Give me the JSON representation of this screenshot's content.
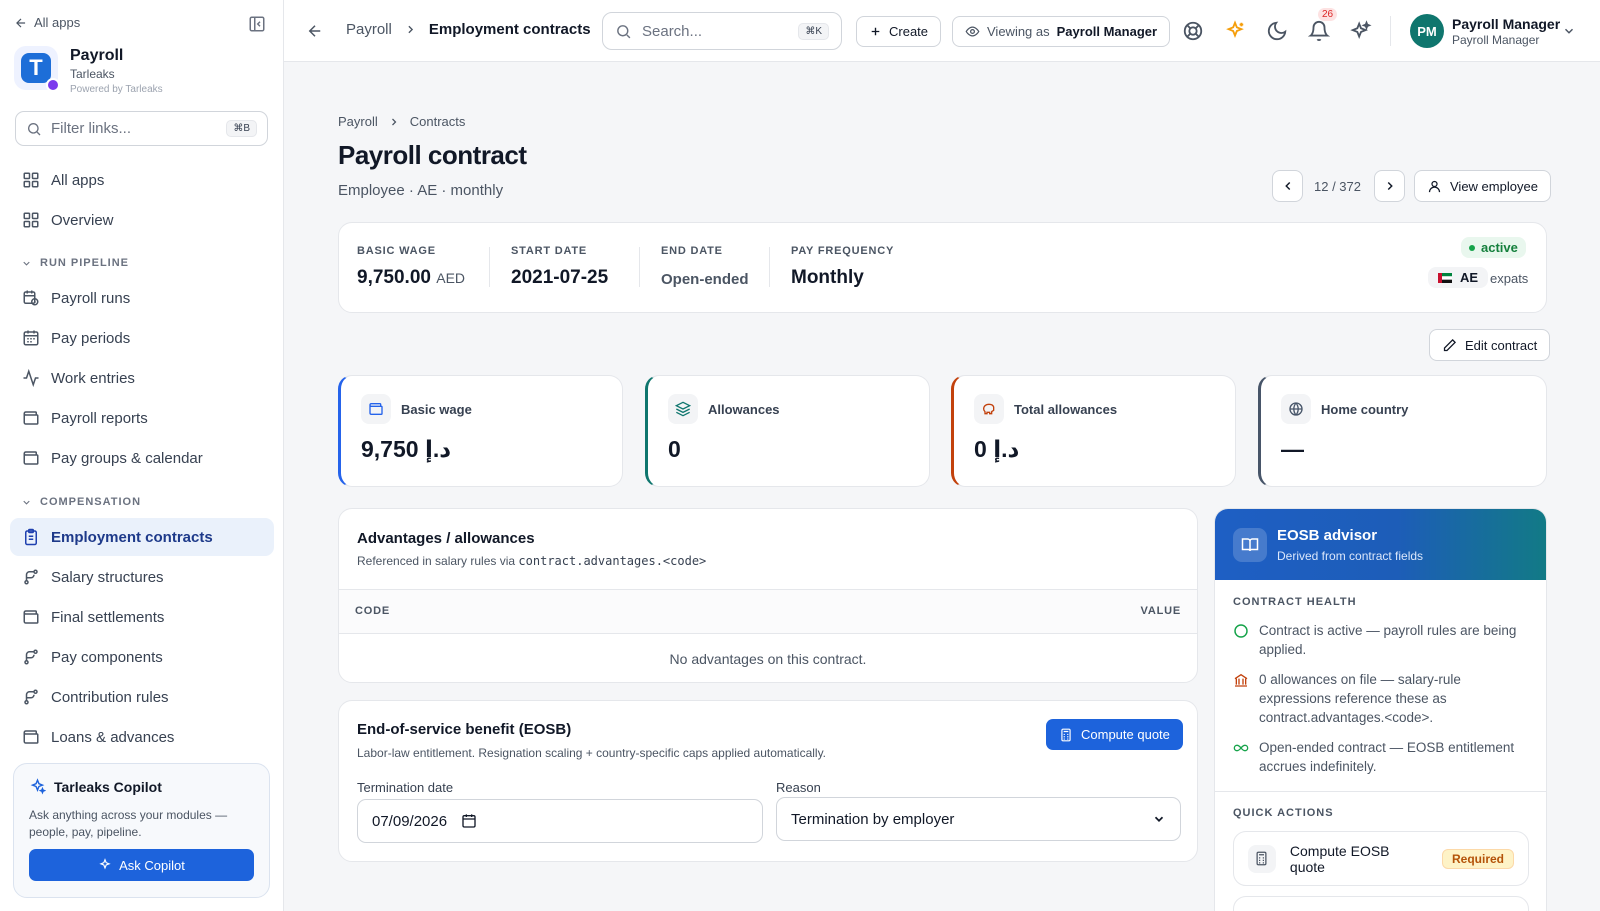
{
  "sidebar": {
    "all_apps": "All apps",
    "brand": {
      "name": "Payroll",
      "org": "Tarleaks",
      "powered": "Powered by Tarleaks",
      "logo_letter": "T"
    },
    "filter": {
      "placeholder": "Filter links...",
      "shortcut": "⌘B"
    },
    "top_items": [
      {
        "label": "All apps",
        "icon": "grid-icon"
      },
      {
        "label": "Overview",
        "icon": "grid-icon"
      }
    ],
    "sections": [
      {
        "title": "RUN PIPELINE",
        "items": [
          {
            "label": "Payroll runs",
            "icon": "calendar-clock-icon"
          },
          {
            "label": "Pay periods",
            "icon": "calendar-icon"
          },
          {
            "label": "Work entries",
            "icon": "activity-icon"
          },
          {
            "label": "Payroll reports",
            "icon": "wallet-icon"
          },
          {
            "label": "Pay groups & calendar",
            "icon": "wallet-icon"
          }
        ]
      },
      {
        "title": "COMPENSATION",
        "items": [
          {
            "label": "Employment contracts",
            "icon": "clipboard-icon",
            "active": true
          },
          {
            "label": "Salary structures",
            "icon": "branch-icon"
          },
          {
            "label": "Final settlements",
            "icon": "wallet-icon"
          },
          {
            "label": "Pay components",
            "icon": "branch-icon"
          },
          {
            "label": "Contribution rules",
            "icon": "branch-icon"
          },
          {
            "label": "Loans & advances",
            "icon": "wallet-icon"
          }
        ]
      }
    ],
    "copilot": {
      "title": "Tarleaks Copilot",
      "desc": "Ask anything across your modules — people, pay, pipeline.",
      "button": "Ask Copilot"
    }
  },
  "topbar": {
    "crumb_root": "Payroll",
    "crumb_current": "Employment contracts",
    "search": {
      "placeholder": "Search...",
      "shortcut": "⌘K"
    },
    "create_label": "Create",
    "viewing_prefix": "Viewing as",
    "viewing_role": "Payroll Manager",
    "notifications_count": "26",
    "user": {
      "initials": "PM",
      "name": "Payroll Manager",
      "role": "Payroll Manager"
    }
  },
  "page": {
    "crumbs": [
      "Payroll",
      "Contracts"
    ],
    "title": "Payroll contract",
    "subtitle": "Employee · AE · monthly",
    "pager": "12 / 372",
    "view_employee": "View employee",
    "edit_contract": "Edit contract"
  },
  "summary": {
    "basic_wage": {
      "label": "BASIC WAGE",
      "value": "9,750.00",
      "unit": "AED"
    },
    "start_date": {
      "label": "START DATE",
      "value": "2021-07-25"
    },
    "end_date": {
      "label": "END DATE",
      "value": "Open-ended"
    },
    "pay_frequency": {
      "label": "PAY FREQUENCY",
      "value": "Monthly"
    },
    "status": "active",
    "country_code": "AE",
    "country_note": "expats"
  },
  "kpis": [
    {
      "label": "Basic wage",
      "value": "9,750 د.إ",
      "icon": "wallet-icon",
      "accent": "#2563eb"
    },
    {
      "label": "Allowances",
      "value": "0",
      "icon": "layers-icon",
      "accent": "#0f766e"
    },
    {
      "label": "Total allowances",
      "value": "0 د.إ",
      "icon": "piggy-bank-icon",
      "accent": "#c2410c"
    },
    {
      "label": "Home country",
      "value": "—",
      "icon": "globe-icon",
      "accent": "#475569"
    }
  ],
  "advantages": {
    "title": "Advantages / allowances",
    "sub_prefix": "Referenced in salary rules via",
    "sub_code": "contract.advantages.<code>",
    "col_code": "CODE",
    "col_value": "VALUE",
    "empty": "No advantages on this contract."
  },
  "eosb": {
    "title": "End-of-service benefit (EOSB)",
    "sub": "Labor-law entitlement. Resignation scaling + country-specific caps applied automatically.",
    "compute_label": "Compute quote",
    "termination_label": "Termination date",
    "termination_value": "07/09/2026",
    "reason_label": "Reason",
    "reason_value": "Termination by employer"
  },
  "advisor": {
    "title": "EOSB advisor",
    "subtitle": "Derived from contract fields",
    "health_label": "CONTRACT HEALTH",
    "health_items": [
      {
        "text": "Contract is active — payroll rules are being applied.",
        "icon": "circle-check-icon",
        "color": "#16a34a"
      },
      {
        "text": "0 allowances on file — salary-rule expressions reference these as contract.advantages.<code>.",
        "icon": "bank-icon",
        "color": "#c2410c"
      },
      {
        "text": "Open-ended contract — EOSB entitlement accrues indefinitely.",
        "icon": "infinity-icon",
        "color": "#16a34a"
      }
    ],
    "quick_label": "QUICK ACTIONS",
    "quick_actions": [
      {
        "label": "Compute EOSB quote",
        "badge": "Required",
        "icon": "calculator-icon"
      }
    ]
  }
}
